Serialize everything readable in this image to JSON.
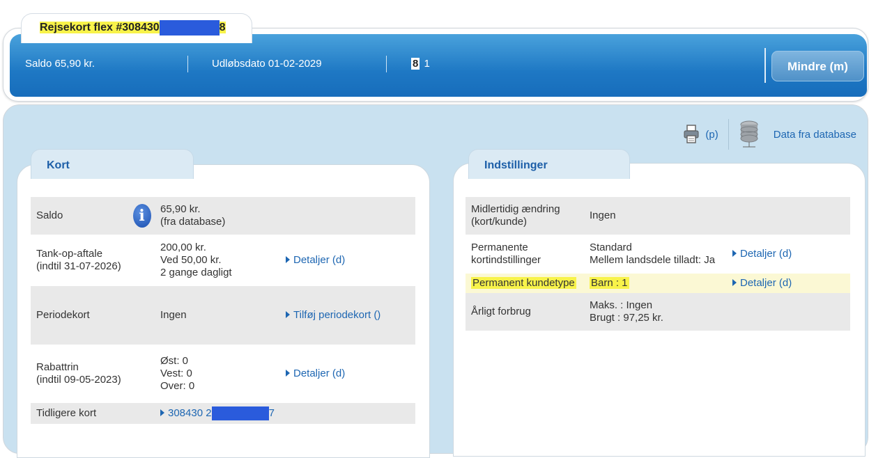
{
  "card": {
    "title_prefix": "Rejsekort flex #308430",
    "title_suffix": "8"
  },
  "header": {
    "saldo": "Saldo 65,90 kr.",
    "expiry": "Udløbsdato 01-02-2029",
    "count_a": "8",
    "count_b": "1",
    "less_button": "Mindre (m)"
  },
  "tools": {
    "print_label": "(p)",
    "database_label": "Data fra database"
  },
  "kort": {
    "tab": "Kort",
    "rows": {
      "saldo": {
        "label": "Saldo",
        "value1": "65,90 kr.",
        "value2": "(fra database)"
      },
      "tankop": {
        "label1": "Tank-op-aftale",
        "label2": "(indtil 31-07-2026)",
        "value1": "200,00 kr.",
        "value2": "Ved 50,00 kr.",
        "value3": "2 gange dagligt",
        "action": "Detaljer (d)"
      },
      "periode": {
        "label": "Periodekort",
        "value": "Ingen",
        "action": "Tilføj periodekort ()"
      },
      "rabat": {
        "label1": "Rabattrin",
        "label2": "(indtil 09-05-2023)",
        "value1": "Øst: 0",
        "value2": "Vest: 0",
        "value3": "Over: 0",
        "action": "Detaljer (d)"
      },
      "tidligere": {
        "label": "Tidligere kort",
        "prefix": "308430 2",
        "suffix": "7"
      }
    }
  },
  "indstillinger": {
    "tab": "Indstillinger",
    "rows": {
      "midlertidig": {
        "label1": "Midlertidig ændring",
        "label2": "(kort/kunde)",
        "value": "Ingen"
      },
      "permanente": {
        "label1": "Permanente",
        "label2": "kortindstillinger",
        "value1": "Standard",
        "value2": "Mellem landsdele tilladt: Ja",
        "action": "Detaljer (d)"
      },
      "kundetype": {
        "label": "Permanent kundetype",
        "value": "Barn : 1",
        "action": "Detaljer (d)"
      },
      "forbrug": {
        "label": "Årligt forbrug",
        "value1": "Maks. : Ingen",
        "value2": "Brugt : 97,25 kr."
      }
    }
  },
  "colors": {
    "header_blue": "#1e78c4",
    "panel_blue": "#c9e1f0",
    "link_blue": "#1d66b2",
    "highlight_yellow": "#f8f34a",
    "redaction_blue": "#2a5bdc"
  }
}
